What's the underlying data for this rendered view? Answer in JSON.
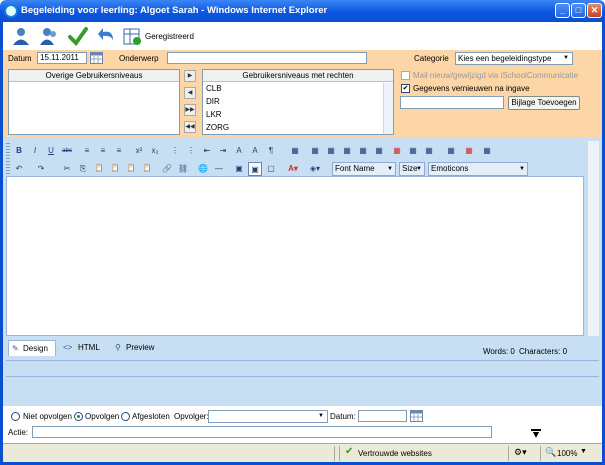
{
  "window": {
    "title": "Begeleiding voor leerling: Algoet Sarah - Windows Internet Explorer",
    "min": "_",
    "max": "□",
    "close": "✕"
  },
  "toolbar": {
    "registered_label": "Geregistreerd door",
    "registered_value": ""
  },
  "form": {
    "datum_label": "Datum",
    "datum_value": "15.11.2011",
    "onderwerp_label": "Onderwerp",
    "onderwerp_value": "",
    "categorie_label": "Categorie",
    "categorie_value": "Kies een begeleidingstype",
    "left_list_header": "Overige Gebruikersniveaus",
    "right_list_header": "Gebruikersniveaus met rechten",
    "right_list_items": [
      "CLB",
      "DIR",
      "LKR",
      "ZORG"
    ],
    "move_buttons": [
      "▶",
      "◀",
      "▶▶",
      "◀◀"
    ],
    "mail_label": "Mail nieuw/gewijzigd via iSchoolCommunicatie",
    "mail_checked": false,
    "gegevens_label": "Gegevens vernieuwen na ingave",
    "gegevens_checked": true,
    "attachment_value": "",
    "attachment_button": "Bijlage Toevoegen"
  },
  "editor": {
    "row1_buttons": [
      "B",
      "I",
      "U",
      "abc",
      "≡",
      "≡",
      "≡",
      "x²",
      "x₂",
      "⋮",
      "⋮",
      "⇤",
      "⇥",
      "A",
      "A",
      "¶",
      "▦",
      "▦",
      "▦",
      "▦",
      "▦",
      "▦",
      "▦",
      "▦",
      "▦",
      "▦",
      "▦",
      "▦"
    ],
    "row2_buttons": [
      "↶",
      "↷",
      "✂",
      "⎘",
      "📋",
      "📋",
      "📋",
      "📋",
      "🔗",
      "⛓",
      "🌐",
      "―",
      "▣",
      "▣",
      "▢"
    ],
    "font_name_label": "Font Name",
    "size_label": "Size",
    "emoticons_label": "Emoticons",
    "tabs": [
      {
        "label": "Design",
        "icon": "pencil-icon"
      },
      {
        "label": "HTML",
        "icon": "code-icon"
      },
      {
        "label": "Preview",
        "icon": "magnifier-icon"
      }
    ],
    "words_label": "Words: 0",
    "characters_label": "Characters: 0"
  },
  "bottom": {
    "radio_options": [
      "Niet opvolgen",
      "Opvolgen",
      "Afgesloten"
    ],
    "selected_radio": "Opvolgen",
    "opvolger_label": "Opvolger:",
    "opvolger_value": "",
    "datum_label": "Datum:",
    "datum_value": "",
    "actie_label": "Actie:",
    "actie_value": ""
  },
  "statusbar": {
    "zone_label": "Vertrouwde websites",
    "zoom_label": "100%"
  },
  "colors": {
    "titlebar": "#0c56e0",
    "form_bg": "#fcd6a6",
    "editor_bg": "#c7def3"
  }
}
